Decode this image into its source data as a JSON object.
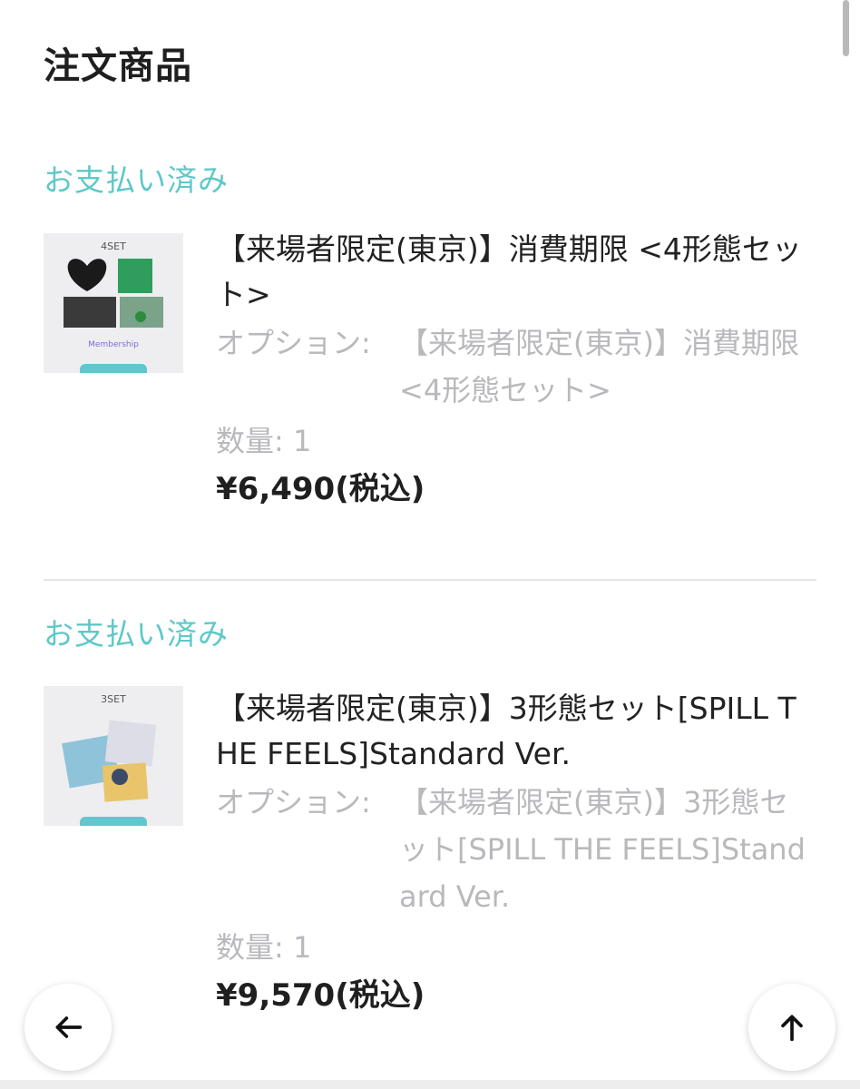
{
  "page": {
    "title": "注文商品"
  },
  "orders": [
    {
      "status": "お支払い済み",
      "thumb_label": "4SET",
      "thumb_membership": "Membership",
      "name": "【来場者限定(東京)】消費期限 <4形態セット>",
      "option_label": "オプション:",
      "option_value": "【来場者限定(東京)】消費期限 <4形態セット>",
      "quantity": "数量: 1",
      "price": "¥6,490(税込)"
    },
    {
      "status": "お支払い済み",
      "thumb_label": "3SET",
      "name": "【来場者限定(東京)】3形態セット[SPILL THE FEELS]Standard Ver.",
      "option_label": "オプション:",
      "option_value": "【来場者限定(東京)】3形態セット[SPILL THE FEELS]Standard Ver.",
      "quantity": "数量: 1",
      "price": "¥9,570(税込)"
    }
  ],
  "nav": {
    "back_icon": "arrow-left-icon",
    "top_icon": "arrow-up-icon"
  },
  "colors": {
    "status": "#5ec8c8",
    "muted": "#b9b9bd",
    "accent": "#63c6cf"
  }
}
